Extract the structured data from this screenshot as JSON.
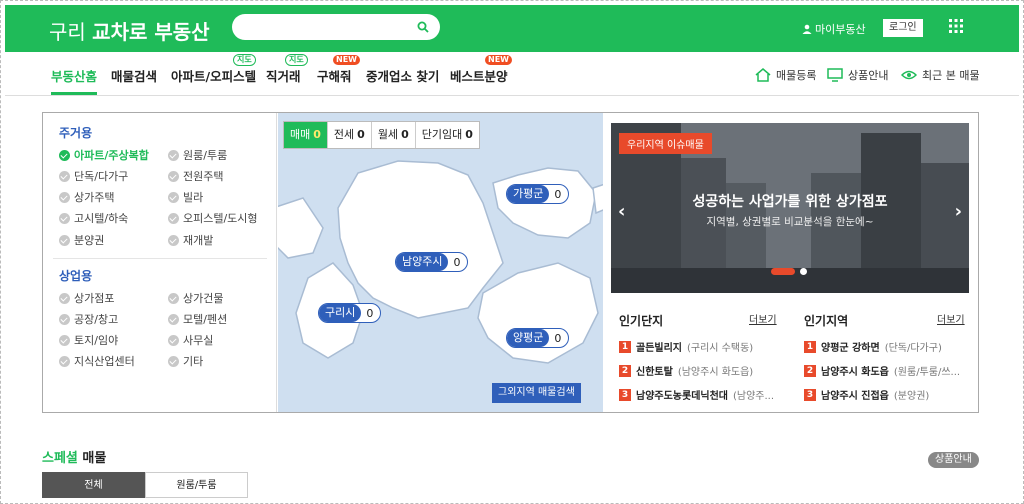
{
  "header": {
    "logo_region": "구리",
    "logo_brand": "교차로 부동산",
    "search_placeholder": "",
    "my_link": "마이부동산",
    "login": "로그인"
  },
  "nav": {
    "items": [
      "부동산홈",
      "매물검색",
      "아파트/오피스텔",
      "직거래",
      "구해줘",
      "중개업소 찾기",
      "베스트분양"
    ],
    "tag_map": "지도",
    "tag_new": "NEW",
    "utils": [
      "매물등록",
      "상품안내",
      "최근 본 매물"
    ]
  },
  "filters": {
    "residential_title": "주거용",
    "residential": [
      "아파트/주상복합",
      "원룸/투룸",
      "단독/다가구",
      "전원주택",
      "상가주택",
      "빌라",
      "고시텔/하숙",
      "오피스텔/도시형",
      "분양권",
      "재개발"
    ],
    "commercial_title": "상업용",
    "commercial": [
      "상가점포",
      "상가건물",
      "공장/창고",
      "모텔/펜션",
      "토지/임야",
      "사무실",
      "지식산업센터",
      "기타"
    ]
  },
  "map": {
    "tabs": [
      {
        "label": "매매",
        "count": "0"
      },
      {
        "label": "전세",
        "count": "0"
      },
      {
        "label": "월세",
        "count": "0"
      },
      {
        "label": "단기임대",
        "count": "0"
      }
    ],
    "regions": [
      {
        "name": "가평군",
        "count": "0"
      },
      {
        "name": "남양주시",
        "count": "0"
      },
      {
        "name": "구리시",
        "count": "0"
      },
      {
        "name": "양평군",
        "count": "0"
      }
    ],
    "other_button": "그외지역 매물검색"
  },
  "banner": {
    "badge": "우리지역 이슈매물",
    "title": "성공하는 사업가를 위한 상가점포",
    "subtitle": "지역별, 상권별로 비교분석을 한눈에~"
  },
  "popular": {
    "complex_title": "인기단지",
    "region_title": "인기지역",
    "more": "더보기",
    "complexes": [
      {
        "rank": "1",
        "name": "골든빌리지",
        "desc": "(구리시 수택동)"
      },
      {
        "rank": "2",
        "name": "신한토탈",
        "desc": "(남양주시 화도읍)"
      },
      {
        "rank": "3",
        "name": "남양주도농롯데닉천대",
        "desc": "(남양주..."
      }
    ],
    "regions": [
      {
        "rank": "1",
        "name": "양평군 강하면",
        "desc": "(단독/다가구)"
      },
      {
        "rank": "2",
        "name": "남양주시 화도읍",
        "desc": "(원룸/투룸/쓰..."
      },
      {
        "rank": "3",
        "name": "남양주시 진접읍",
        "desc": "(분양권)"
      }
    ]
  },
  "special": {
    "title_accent": "스페셜",
    "title_rest": " 매물",
    "product_button": "상품안내",
    "tabs": [
      "전체",
      "원룸/투룸"
    ]
  },
  "colors": {
    "brand": "#1fbb59",
    "accent_blue": "#2f5fba",
    "accent_red": "#e84a2b"
  }
}
